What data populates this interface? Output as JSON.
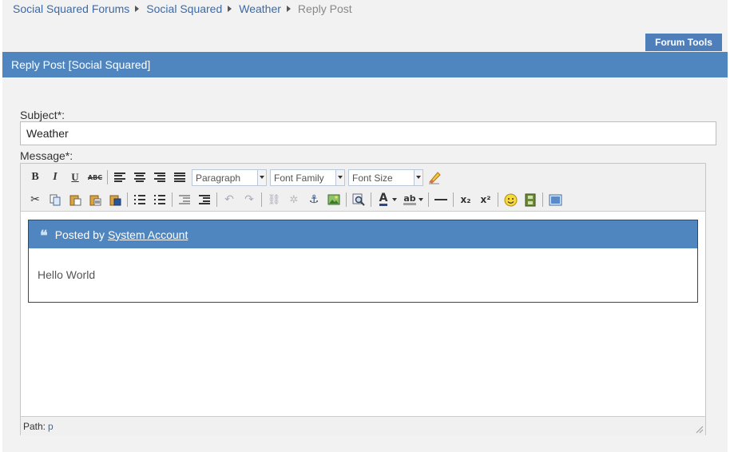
{
  "breadcrumb": {
    "items": [
      "Social Squared Forums",
      "Social Squared",
      "Weather",
      "Reply Post"
    ]
  },
  "forum_tools": {
    "label": "Forum Tools"
  },
  "title_bar": {
    "title": "Reply Post [Social Squared]"
  },
  "form": {
    "subject_label": "Subject*:",
    "subject_value": "Weather",
    "message_label": "Message*:"
  },
  "toolbar": {
    "row1": {
      "bold_label": "B",
      "italic_label": "I",
      "underline_label": "U",
      "strike_label": "ABC",
      "format_select": "Paragraph",
      "font_family_select": "Font Family",
      "font_size_select": "Font Size"
    },
    "row2": {
      "text_color_label": "A",
      "highlight_label": "ab",
      "subscript_label": "x₂",
      "superscript_label": "x²"
    }
  },
  "quote": {
    "posted_by_prefix": "Posted by",
    "author": "System Account",
    "body": "Hello World"
  },
  "path_bar": {
    "label": "Path:",
    "value": "p"
  },
  "colors": {
    "accent": "#4f86c0",
    "link": "#3a6aa8",
    "background": "#f2f2f2"
  }
}
